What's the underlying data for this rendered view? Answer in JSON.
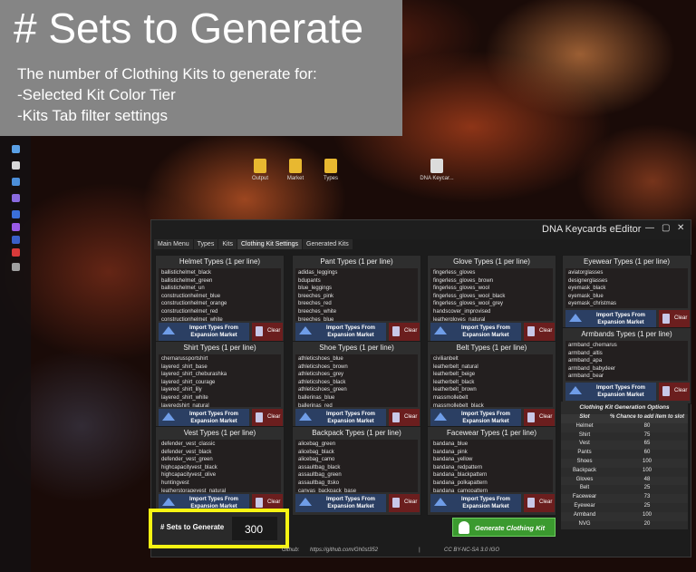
{
  "banner": {
    "title": "# Sets to Generate",
    "description": "The number of Clothing Kits to generate for:\n-Selected Kit Color Tier\n-Kits Tab filter settings"
  },
  "desktop": {
    "icons": [
      {
        "label": "Output",
        "icon": "folder-icon"
      },
      {
        "label": "Market",
        "icon": "folder-icon"
      },
      {
        "label": "Types",
        "icon": "folder-icon"
      },
      {
        "label": "DNA Keycar...",
        "icon": "file-icon"
      }
    ]
  },
  "window": {
    "title": "DNA Keycards eEditor",
    "min": "—",
    "max": "▢",
    "close": "✕"
  },
  "tabs": [
    "Main Menu",
    "Types",
    "Kits",
    "Clothing Kit Settings",
    "Generated Kits"
  ],
  "import_label": "Import Types From Expansion Market",
  "clear_label": "Clear",
  "panels": [
    {
      "title": "Helmet Types (1 per line)",
      "items": [
        "ballistichelmet_black",
        "ballistichelmet_green",
        "ballistichelmet_un",
        "constructionhelmet_blue",
        "constructionhelmet_orange",
        "constructionhelmet_red",
        "constructionhelmet_white"
      ]
    },
    {
      "title": "Pant Types (1 per line)",
      "items": [
        "adidas_leggings",
        "bdupants",
        "blue_leggings",
        "breeches_pink",
        "breeches_red",
        "breeches_white",
        "breeches_blue"
      ]
    },
    {
      "title": "Glove Types (1 per line)",
      "items": [
        "fingerless_gloves",
        "fingerless_gloves_brown",
        "fingerless_gloves_wool",
        "fingerless_gloves_wool_black",
        "fingerless_gloves_wool_grey",
        "handscover_improvised",
        "leathergloves_natural"
      ]
    },
    {
      "title": "Eyewear Types (1 per line)",
      "items": [
        "aviatorglasses",
        "designerglasses",
        "eyemask_black",
        "eyemask_blue",
        "eyemask_christmas"
      ]
    },
    {
      "title": "Shirt Types (1 per line)",
      "items": [
        "chernarussportshirt",
        "layered_shirt_base",
        "layered_shirt_cheburashka",
        "layered_shirt_courage",
        "layered_shirt_lily",
        "layered_shirt_white",
        "layeredshirt_natural"
      ]
    },
    {
      "title": "Shoe Types (1 per line)",
      "items": [
        "athleticshoes_blue",
        "athleticshoes_brown",
        "athleticshoes_grey",
        "athleticshoes_black",
        "athleticshoes_green",
        "ballerinas_blue",
        "ballerinas_red"
      ]
    },
    {
      "title": "Belt Types (1 per line)",
      "items": [
        "civilianbelt",
        "leatherbelt_natural",
        "leatherbelt_beige",
        "leatherbelt_black",
        "leatherbelt_brown",
        "massmollebelt",
        "massmollebelt_black"
      ]
    },
    {
      "title": "Armbands Types (1 per line)",
      "items": [
        "armband_chernarus",
        "armband_altis",
        "armband_apa",
        "armband_babydeer",
        "armband_bear"
      ]
    },
    {
      "title": "Vest Types (1 per line)",
      "items": [
        "defender_vest_classic",
        "defender_vest_black",
        "defender_vest_green",
        "highcapacityvest_black",
        "highcapacityvest_olive",
        "huntingvest",
        "leatherstoragevest_natural"
      ]
    },
    {
      "title": "Backpack Types (1 per line)",
      "items": [
        "alicebag_green",
        "alicebag_black",
        "alicebag_camo",
        "assaultbag_black",
        "assaultbag_green",
        "assaultbag_ttsko",
        "canvas_backpack_base"
      ]
    },
    {
      "title": "Facewear Types (1 per line)",
      "items": [
        "bandana_blue",
        "bandana_pink",
        "bandana_yellow",
        "bandana_redpattern",
        "bandana_blackpattern",
        "bandana_polkapattern",
        "bandana_camopattern"
      ]
    }
  ],
  "kit_options": {
    "title": "Clothing Kit Generation Options",
    "headers": [
      "Slot",
      "% Chance to add item to slot"
    ],
    "rows": [
      [
        "Helmet",
        "80"
      ],
      [
        "Shirt",
        "75"
      ],
      [
        "Vest",
        "65"
      ],
      [
        "Pants",
        "60"
      ],
      [
        "Shoes",
        "100"
      ],
      [
        "Backpack",
        "100"
      ],
      [
        "Gloves",
        "48"
      ],
      [
        "Belt",
        "25"
      ],
      [
        "Facewear",
        "73"
      ],
      [
        "Eyewear",
        "25"
      ],
      [
        "Armband",
        "100"
      ],
      [
        "NVG",
        "20"
      ]
    ]
  },
  "sets": {
    "label": "# Sets to Generate",
    "value": "300"
  },
  "generate": {
    "label": "Generate Clothing Kit"
  },
  "footer": {
    "github_label": "Github:",
    "github_url": "https://github.com/Gh0st352",
    "sep": "|",
    "license": "CC BY-NC-SA 3.0 IGO"
  }
}
